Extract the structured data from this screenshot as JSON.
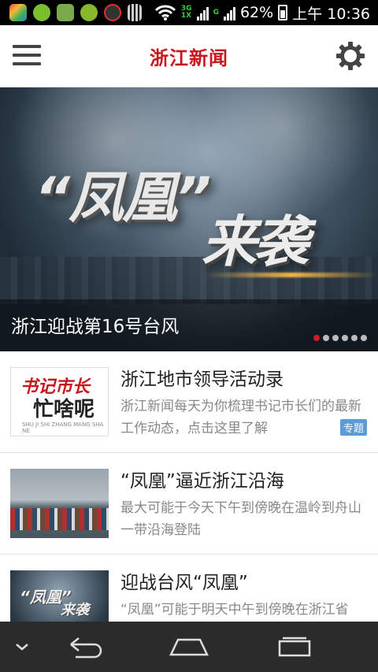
{
  "status_bar": {
    "battery": "62%",
    "time": "上午 10:36",
    "network_top": "3G",
    "network_bottom": "1X",
    "network_g": "G"
  },
  "header": {
    "title": "浙江新闻",
    "menu_icon": "menu-icon",
    "settings_icon": "gear-icon"
  },
  "banner": {
    "art_text_1": "“凤凰”",
    "art_text_2": "来袭",
    "caption": "浙江迎战第16号台风",
    "page_count": 6,
    "active_page": 1
  },
  "news": [
    {
      "title": "浙江地市领导活动录",
      "desc": "浙江新闻每天为你梳理书记市长们的最新工作动态，点击这里了解",
      "tag": "专题",
      "thumb_line1": "书记市长",
      "thumb_line2": "忙啥呢",
      "thumb_line3": "SHU JI SHI ZHANG MANG SHA NE"
    },
    {
      "title": "“凤凰”逼近浙江沿海",
      "desc": "最大可能于今天下午到傍晚在温岭到舟山一带沿海登陆"
    },
    {
      "title": "迎战台风“凤凰”",
      "desc": "“凤凰”可能于明天中午到傍晚在浙江省",
      "thumb_line1": "“凤凰”",
      "thumb_line2": "来袭"
    }
  ],
  "nav": {
    "collapse_icon": "chevron-down-icon",
    "back_icon": "back-icon",
    "home_icon": "home-icon",
    "recent_icon": "recent-apps-icon"
  },
  "colors": {
    "brand_red": "#c8161d",
    "tag_blue": "#5b9bd6",
    "navbar": "#2b2b2b"
  }
}
